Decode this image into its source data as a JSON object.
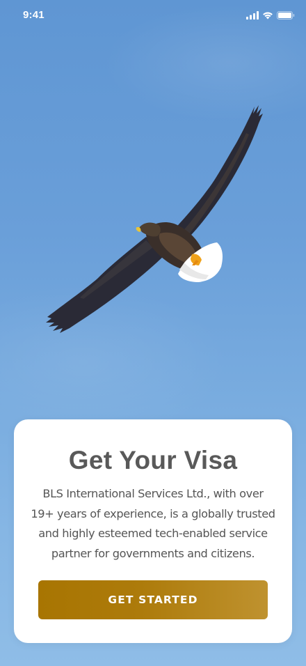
{
  "status_bar": {
    "time": "9:41",
    "icons": [
      "cellular-signal-icon",
      "wifi-icon",
      "battery-icon"
    ]
  },
  "hero": {
    "image": "eagle-in-flight"
  },
  "card": {
    "title": "Get Your Visa",
    "description": "BLS International Services Ltd., with over 19+ years of experience, is a globally trusted and highly esteemed tech-enabled service partner for governments and citizens.",
    "button_label": "GET STARTED"
  },
  "colors": {
    "sky_top": "#5f96d3",
    "sky_bottom": "#8fbde7",
    "button_start": "#a87502",
    "button_end": "#bf922f",
    "title_text": "#595959",
    "body_text": "#555555"
  }
}
